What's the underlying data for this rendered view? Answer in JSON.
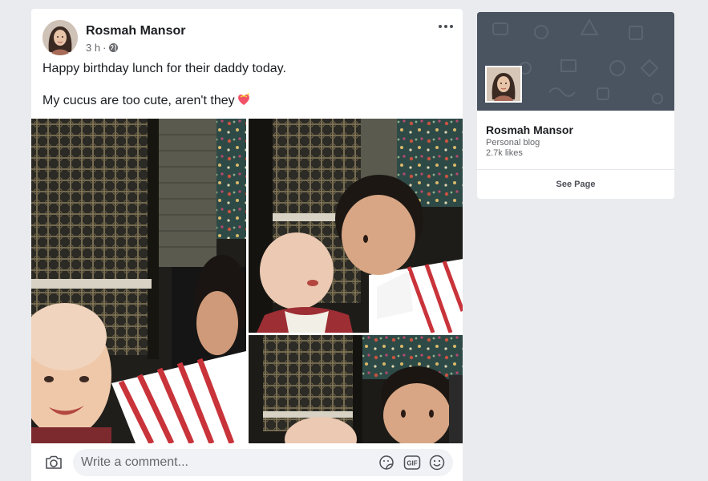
{
  "post": {
    "author": "Rosmah Mansor",
    "time": "3 h",
    "separator": "·",
    "text_line_1": "Happy birthday lunch for their daddy today.",
    "text_line_2": "My cucus are too cute, aren't they",
    "more_icon": "ellipsis-icon",
    "privacy_icon": "globe-icon"
  },
  "comment_bar": {
    "placeholder": "Write a comment...",
    "icons": [
      "camera-icon",
      "sticker-icon",
      "gif-icon",
      "emoji-icon"
    ],
    "gif_label": "GIF"
  },
  "page_card": {
    "name": "Rosmah Mansor",
    "category": "Personal blog",
    "likes": "2.7k likes",
    "button_label": "See Page"
  },
  "colors": {
    "background": "#e9ebee",
    "card": "#ffffff",
    "cover": "#4a5360",
    "secondary_text": "#65676b",
    "heart": "#f25268"
  }
}
